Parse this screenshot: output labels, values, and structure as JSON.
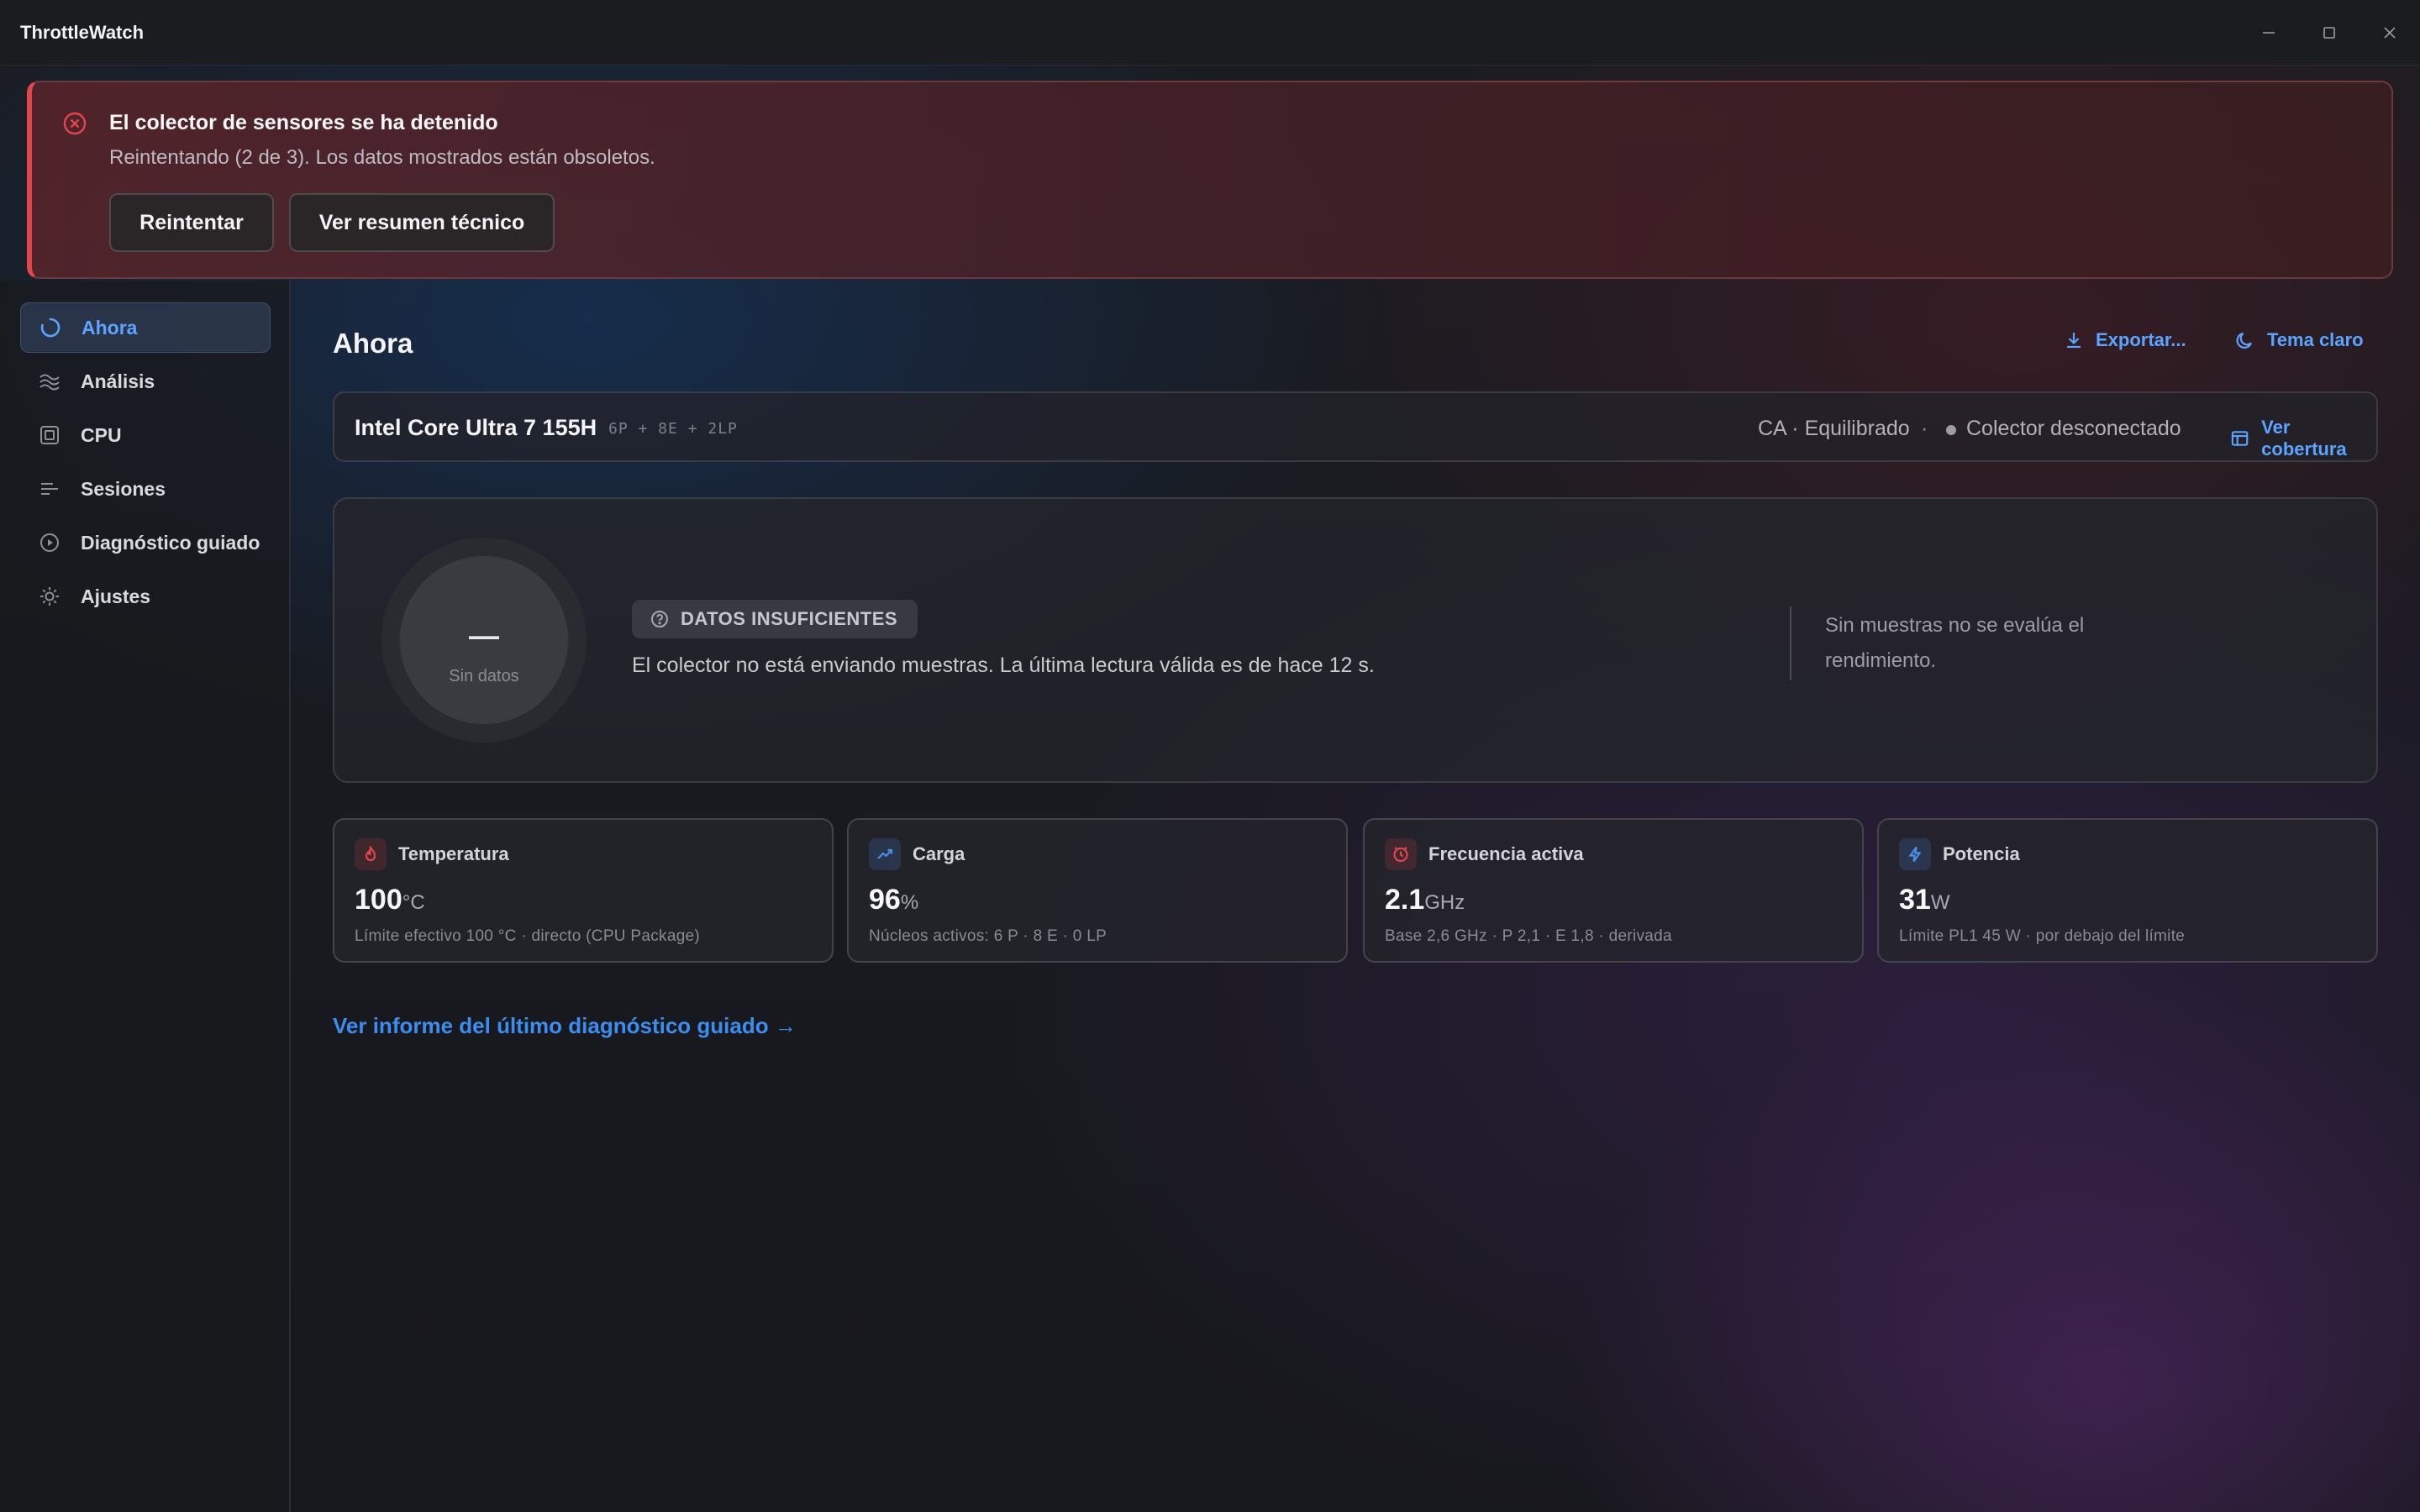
{
  "window": {
    "title": "ThrottleWatch"
  },
  "banner": {
    "title": "El colector de sensores se ha detenido",
    "subtitle": "Reintentando (2 de 3). Los datos mostrados están obsoletos.",
    "retry_label": "Reintentar",
    "summary_label": "Ver resumen técnico",
    "accent_color": "#e0464c"
  },
  "sidebar": {
    "items": [
      {
        "label": "Ahora",
        "icon": "spinner-icon",
        "active": true
      },
      {
        "label": "Análisis",
        "icon": "waves-icon",
        "active": false
      },
      {
        "label": "CPU",
        "icon": "chip-icon",
        "active": false
      },
      {
        "label": "Sesiones",
        "icon": "bars-icon",
        "active": false
      },
      {
        "label": "Diagnóstico guiado",
        "icon": "play-circle-icon",
        "active": false
      },
      {
        "label": "Ajustes",
        "icon": "gear-icon",
        "active": false
      }
    ]
  },
  "header": {
    "title": "Ahora",
    "export_label": "Exportar...",
    "theme_label": "Tema claro"
  },
  "cpu": {
    "name": "Intel Core Ultra 7 155H",
    "cores": "6P + 8E + 2LP",
    "power_mode": "CA · Equilibrado",
    "separator": "·",
    "collector_status": "Colector desconectado",
    "coverage_label": "Ver cobertura"
  },
  "state": {
    "gauge_value": "—",
    "gauge_label": "Sin datos",
    "badge": "DATOS INSUFICIENTES",
    "message": "El colector no está enviando muestras. La última lectura válida es de hace 12 s.",
    "side_note": "Sin muestras no se evalúa el rendimiento."
  },
  "metrics": [
    {
      "label": "Temperatura",
      "value": "100",
      "unit": "°C",
      "detail": "Límite efectivo 100 °C · directo (CPU Package)",
      "icon": "flame-icon",
      "color": "#e0464c"
    },
    {
      "label": "Carga",
      "value": "96",
      "unit": "%",
      "detail": "Núcleos activos: 6 P · 8 E · 0 LP",
      "icon": "trend-icon",
      "color": "#4a8fe8"
    },
    {
      "label": "Frecuencia activa",
      "value": "2.1",
      "unit": "GHz",
      "detail": "Base 2,6 GHz · P 2,1 · E 1,8 · derivada",
      "icon": "clock-icon",
      "color": "#e0464c"
    },
    {
      "label": "Potencia",
      "value": "31",
      "unit": "W",
      "detail": "Límite PL1 45 W · por debajo del límite",
      "icon": "bolt-icon",
      "color": "#4a8fe8"
    }
  ],
  "footer_link": "Ver informe del último diagnóstico guiado →",
  "colors": {
    "accent": "#5ba4ff",
    "error": "#e0464c"
  }
}
